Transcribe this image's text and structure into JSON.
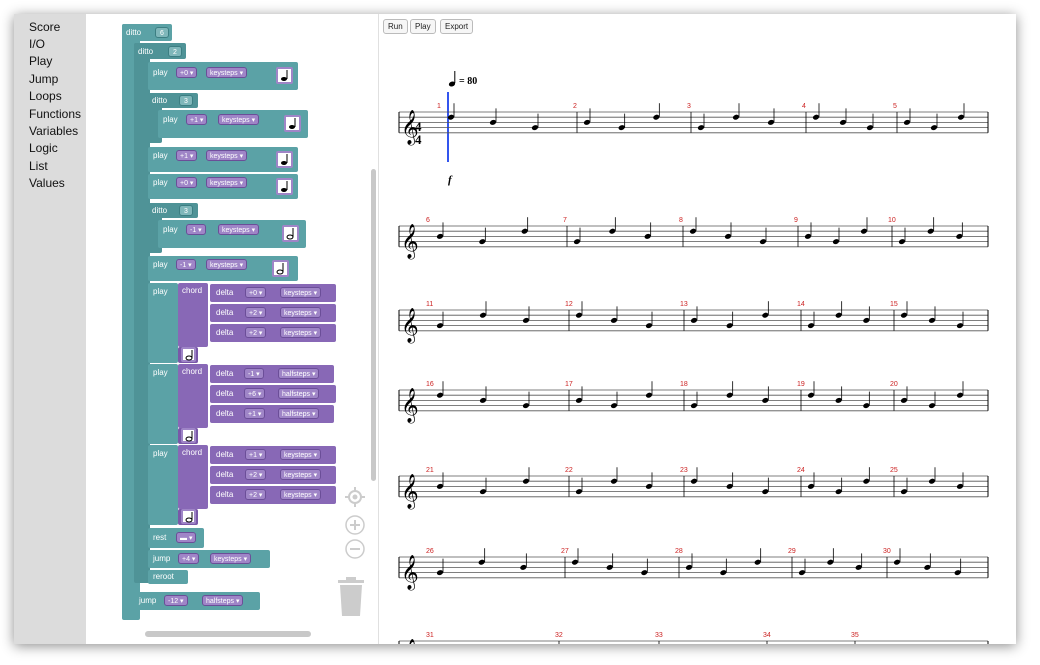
{
  "sidebar": {
    "categories": [
      "Score",
      "I/O",
      "Play",
      "Jump",
      "Loops",
      "Functions",
      "Variables",
      "Logic",
      "List",
      "Values"
    ]
  },
  "toolbar": {
    "run": "Run",
    "play": "Play",
    "export": "Export"
  },
  "blocks": {
    "ditto": "ditto",
    "play": "play",
    "chord": "chord",
    "delta": "delta",
    "rest": "rest",
    "jump": "jump",
    "reroot": "reroot",
    "keysteps": "keysteps ▾",
    "halfsteps": "halfsteps ▾",
    "ditto_outer_count": "6",
    "ditto_inner_count": "2",
    "ditto_three": "3",
    "v_plus0": "+0 ▾",
    "v_plus1": "+1 ▾",
    "v_minus1": "-1 ▾",
    "v_plus2": "+2 ▾",
    "v_plus6": "+6 ▾",
    "v_plus4": "+4 ▾",
    "v_minus12": "-12 ▾",
    "rest_value": "▬ ▾"
  },
  "score": {
    "tempo": "= 80",
    "time_signature_top": "4",
    "time_signature_bottom": "4",
    "dynamic": "f",
    "measure_numbers": [
      "1",
      "2",
      "3",
      "4",
      "5",
      "6",
      "7",
      "8",
      "9",
      "10",
      "11",
      "12",
      "13",
      "14",
      "15",
      "16",
      "17",
      "18",
      "19",
      "20",
      "21",
      "22",
      "23",
      "24",
      "25",
      "26",
      "27",
      "28",
      "29",
      "30",
      "31",
      "32",
      "33",
      "34",
      "35"
    ],
    "colors": {
      "measure_number": "#cc2222",
      "playhead": "#3355ee",
      "teal": "#5ba2a6",
      "purple": "#8868b6"
    }
  },
  "icons": {
    "target": "target-icon",
    "zoom_in": "zoom-in-icon",
    "zoom_out": "zoom-out-icon",
    "trash": "trash-icon"
  }
}
